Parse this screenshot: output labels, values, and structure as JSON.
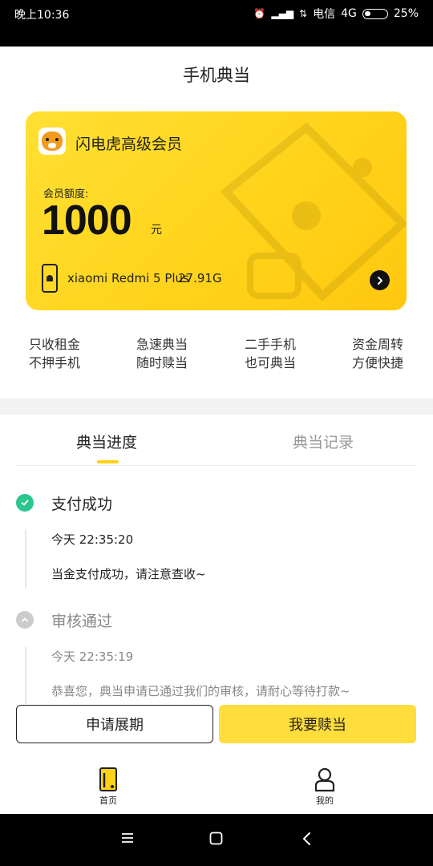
{
  "status_bar": {
    "time": "晚上10:36",
    "carrier": "电信",
    "network": "4G",
    "battery": "25%",
    "icons": [
      "alarm-icon",
      "signal-icon",
      "signal-icon",
      "battery-icon"
    ]
  },
  "page": {
    "title": "手机典当"
  },
  "member_card": {
    "name": "闪电虎高级会员",
    "quota_label": "会员额度:",
    "quota_value": "1000",
    "quota_unit": "元",
    "device_name": "xiaomi Redmi 5 Plus",
    "device_storage": "27.91G",
    "colors": {
      "card_start": "#FFE033",
      "card_end": "#FFC80F"
    }
  },
  "features": [
    {
      "line1": "只收租金",
      "line2": "不押手机"
    },
    {
      "line1": "急速典当",
      "line2": "随时赎当"
    },
    {
      "line1": "二手手机",
      "line2": "也可典当"
    },
    {
      "line1": "资金周转",
      "line2": "方便快捷"
    }
  ],
  "tabs": [
    {
      "label": "典当进度",
      "active": true
    },
    {
      "label": "典当记录",
      "active": false
    }
  ],
  "timeline": [
    {
      "title": "支付成功",
      "time": "今天 22:35:20",
      "desc": "当金支付成功，请注意查收~",
      "status": "done",
      "color": "#2BC68F"
    },
    {
      "title": "审核通过",
      "time": "今天 22:35:19",
      "desc": "恭喜您，典当申请已通过我们的审核，请耐心等待打款~",
      "status": "collapsed",
      "color": "#cccccc"
    }
  ],
  "actions": {
    "extend_label": "申请展期",
    "redeem_label": "我要赎当"
  },
  "bottom_nav": [
    {
      "label": "首页",
      "icon": "home-phone-icon"
    },
    {
      "label": "我的",
      "icon": "profile-icon"
    }
  ],
  "system_nav": [
    "menu-icon",
    "home-icon",
    "back-icon"
  ],
  "accent_color": "#FFDD3C"
}
